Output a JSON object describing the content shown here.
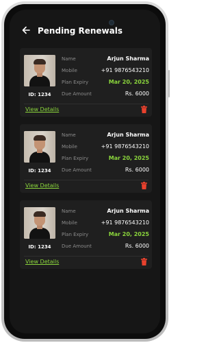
{
  "header": {
    "back_icon": "arrow-left-icon",
    "title": "Pending Renewals"
  },
  "labels": {
    "name": "Name",
    "mobile": "Mobile",
    "plan_expiry": "Plan Expiry",
    "due_amount": "Due Amount"
  },
  "colors": {
    "accent_green": "#8bd63c",
    "delete_red": "#e8412d",
    "background": "#161616",
    "card": "#1f1f1f"
  },
  "cards": [
    {
      "id_text": "ID: 1234",
      "name": "Arjun Sharma",
      "mobile": "+91 9876543210",
      "plan_expiry": "Mar 20, 2025",
      "due_amount": "Rs. 6000",
      "action_label": "View Details",
      "delete_icon": "trash-icon"
    },
    {
      "id_text": "ID: 1234",
      "name": "Arjun Sharma",
      "mobile": "+91 9876543210",
      "plan_expiry": "Mar 20, 2025",
      "due_amount": "Rs. 6000",
      "action_label": "View Details",
      "delete_icon": "trash-icon"
    },
    {
      "id_text": "ID: 1234",
      "name": "Arjun Sharma",
      "mobile": "+91 9876543210",
      "plan_expiry": "Mar 20, 2025",
      "due_amount": "Rs. 6000",
      "action_label": "View Details",
      "delete_icon": "trash-icon"
    }
  ]
}
